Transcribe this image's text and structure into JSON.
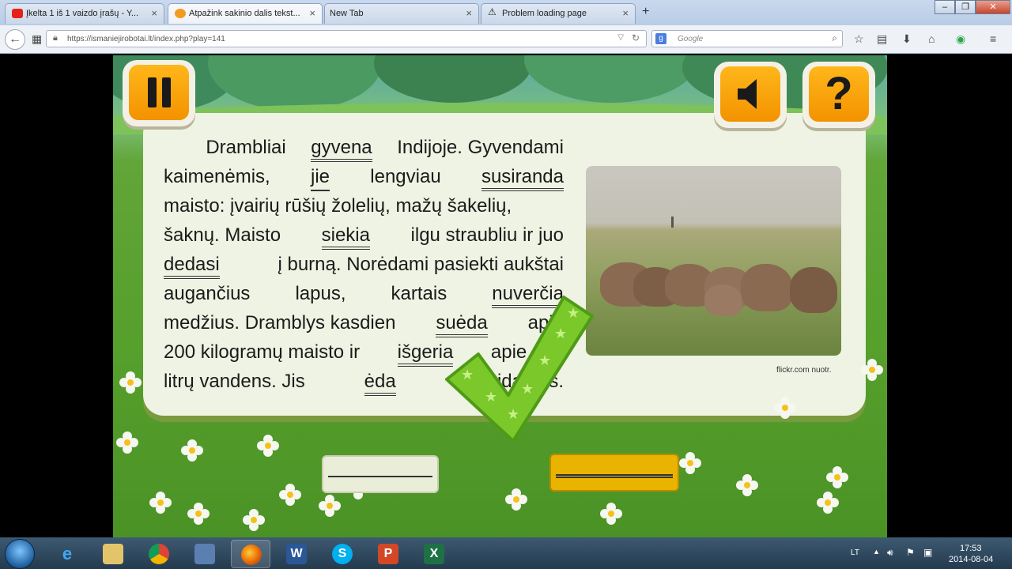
{
  "browser": {
    "tabs": [
      {
        "label": "Įkelta 1 iš 1 vaizdo įrašų - Y...",
        "icon": "youtube-icon",
        "active": false
      },
      {
        "label": "Atpažink sakinio dalis tekst...",
        "icon": "game-icon",
        "active": true
      },
      {
        "label": "New Tab",
        "icon": "",
        "active": false
      },
      {
        "label": "Problem loading page",
        "icon": "warning-icon",
        "active": false
      }
    ],
    "new_tab_label": "+",
    "url": "https://ismaniejirobotai.lt/index.php?play=141",
    "search_placeholder": "Google"
  },
  "game": {
    "text_lines": [
      [
        {
          "t": "        Drambliai "
        },
        {
          "t": "gyvena",
          "u": 2
        },
        {
          "t": " Indijoje. Gyvendami"
        }
      ],
      [
        {
          "t": "kaimenėmis,"
        },
        {
          "t": "jie",
          "u": 1
        },
        {
          "t": "lengviau"
        },
        {
          "t": "susiranda",
          "u": 2
        }
      ],
      [
        {
          "t": "maisto: įvairių rūšių žolelių, mažų šakelių,"
        }
      ],
      [
        {
          "t": "šaknų. Maisto "
        },
        {
          "t": "siekia",
          "u": 2
        },
        {
          "t": " ilgu straubliu ir juo"
        }
      ],
      [
        {
          "t": "dedasi",
          "u": 2
        },
        {
          "t": " į burną. Norėdami pasiekti aukštai"
        }
      ],
      [
        {
          "t": "augančius"
        },
        {
          "t": "lapus,"
        },
        {
          "t": "kartais"
        },
        {
          "t": "nuverčia",
          "u": 2
        }
      ],
      [
        {
          "t": "medžius. Dramblys kasdien "
        },
        {
          "t": "suėda",
          "u": 2
        },
        {
          "t": " apie"
        }
      ],
      [
        {
          "t": "200 kilogramų maisto ir "
        },
        {
          "t": "išgeria",
          "u": 2
        },
        {
          "t": " apie 150"
        }
      ],
      [
        {
          "t": "litrų vandens. Jis "
        },
        {
          "t": "ėda",
          "u": 2
        },
        {
          "t": " net eidamas."
        }
      ]
    ],
    "photo_credit": "flickr.com nuotr.",
    "pause_icon": "pause-icon",
    "sound_icon": "speaker-icon",
    "help_symbol": "?",
    "answer_left_style": "single-underline",
    "answer_right_style": "double-underline",
    "colors": {
      "orange": "#f39200",
      "gold": "#e9b300",
      "check_green": "#7ac82a"
    }
  },
  "taskbar": {
    "apps": [
      "ie-icon",
      "explorer-icon",
      "chrome-icon",
      "save-icon",
      "firefox-icon",
      "word-icon",
      "skype-icon",
      "powerpoint-icon",
      "excel-icon"
    ],
    "tray_lang": "LT",
    "time": "17:53",
    "date": "2014-08-04"
  }
}
